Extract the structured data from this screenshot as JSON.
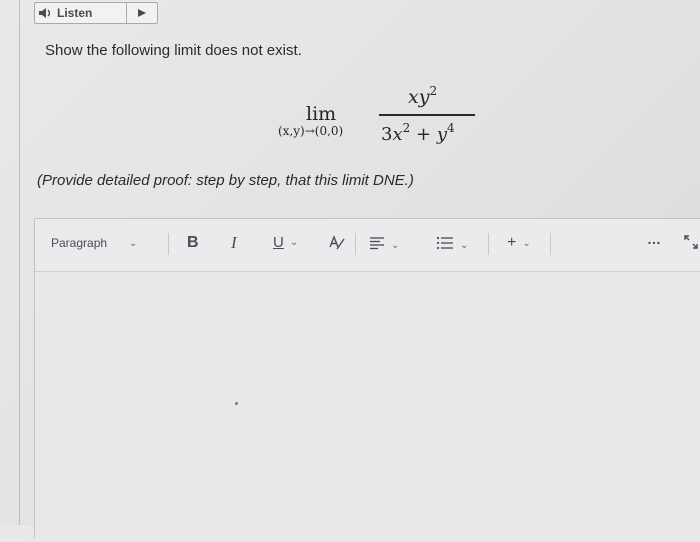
{
  "listen_widget": {
    "label": "Listen"
  },
  "question": {
    "prompt": "Show the following limit does not exist.",
    "limit": {
      "operator": "lim",
      "subscript": "(x,y)→(0,0)",
      "numerator_base": "xy",
      "numerator_exp": "2",
      "denominator_coeff": "3",
      "denominator_var1": "x",
      "denominator_exp1": "2",
      "denominator_plus": "+",
      "denominator_var2": "y",
      "denominator_exp2": "4"
    },
    "instruction": "(Provide detailed proof: step by step, that this limit DNE.)"
  },
  "editor": {
    "paragraph_label": "Paragraph",
    "bold_label": "B",
    "italic_label": "I",
    "underline_label": "U",
    "insert_label": "+",
    "more_label": "…"
  },
  "icons": {
    "speaker": "speaker-icon",
    "play": "play-icon",
    "text_color": "text-color-icon",
    "align": "align-icon",
    "list": "list-icon",
    "more": "more-icon",
    "expand": "expand-icon"
  }
}
